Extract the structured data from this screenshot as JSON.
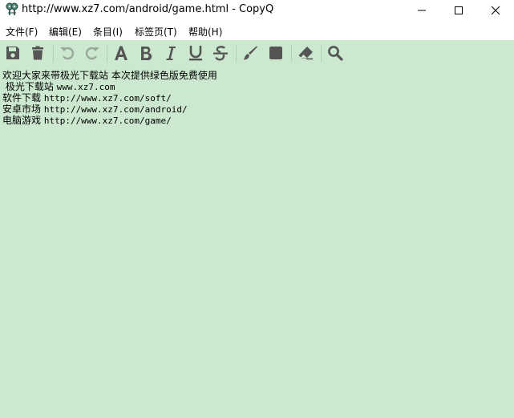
{
  "window": {
    "title": "http://www.xz7.com/android/game.html - CopyQ"
  },
  "menu": {
    "items": [
      {
        "label": "文件(F)"
      },
      {
        "label": "编辑(E)"
      },
      {
        "label": "条目(I)"
      },
      {
        "label": "标签页(T)"
      },
      {
        "label": "帮助(H)"
      }
    ]
  },
  "toolbar": {
    "buttons": [
      {
        "icon": "save-icon",
        "enabled": true
      },
      {
        "icon": "trash-icon",
        "enabled": true
      },
      {
        "icon": "undo-icon",
        "enabled": false
      },
      {
        "icon": "redo-icon",
        "enabled": false
      },
      {
        "icon": "font-icon",
        "enabled": true
      },
      {
        "icon": "bold-icon",
        "enabled": true
      },
      {
        "icon": "italic-icon",
        "enabled": true
      },
      {
        "icon": "underline-icon",
        "enabled": true
      },
      {
        "icon": "strikethrough-icon",
        "enabled": true
      },
      {
        "icon": "paintbrush-icon",
        "enabled": true
      },
      {
        "icon": "square-icon",
        "enabled": true
      },
      {
        "icon": "eraser-icon",
        "enabled": true
      },
      {
        "icon": "search-icon",
        "enabled": true
      }
    ]
  },
  "editor": {
    "lines": [
      {
        "cjk": "欢迎大家来带极光下载站 本次提供绿色版免费使用",
        "mono": ""
      },
      {
        "cjk": " 极光下载站 ",
        "mono": "www.xz7.com"
      },
      {
        "cjk": "软件下载 ",
        "mono": "http://www.xz7.com/soft/"
      },
      {
        "cjk": "安卓市场 ",
        "mono": "http://www.xz7.com/android/"
      },
      {
        "cjk": "电脑游戏 ",
        "mono": "http://www.xz7.com/game/"
      }
    ]
  },
  "colors": {
    "content_bg": "#cce8cf",
    "icon_color": "#555555",
    "icon_disabled": "#9aa89c"
  }
}
